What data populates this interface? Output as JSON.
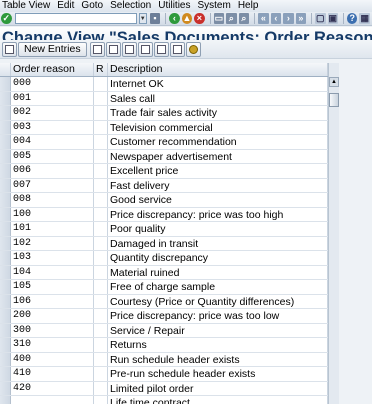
{
  "menu": [
    "Table View",
    "Edit",
    "Goto",
    "Selection",
    "Utilities",
    "System",
    "Help"
  ],
  "title": "Change View \"Sales Documents: Order Reasons\": O",
  "app_toolbar": {
    "new_entries_label": "New Entries"
  },
  "table": {
    "columns": [
      "Order reason",
      "R",
      "Description"
    ],
    "rows": [
      {
        "code": "000",
        "desc": "Internet OK"
      },
      {
        "code": "001",
        "desc": "Sales call"
      },
      {
        "code": "002",
        "desc": "Trade fair sales activity"
      },
      {
        "code": "003",
        "desc": "Television commercial"
      },
      {
        "code": "004",
        "desc": "Customer recommendation"
      },
      {
        "code": "005",
        "desc": "Newspaper advertisement"
      },
      {
        "code": "006",
        "desc": "Excellent price"
      },
      {
        "code": "007",
        "desc": "Fast delivery"
      },
      {
        "code": "008",
        "desc": "Good service"
      },
      {
        "code": "100",
        "desc": "Price discrepancy: price was too high"
      },
      {
        "code": "101",
        "desc": "Poor quality"
      },
      {
        "code": "102",
        "desc": "Damaged in transit"
      },
      {
        "code": "103",
        "desc": "Quantity discrepancy"
      },
      {
        "code": "104",
        "desc": "Material ruined"
      },
      {
        "code": "105",
        "desc": "Free of charge sample"
      },
      {
        "code": "106",
        "desc": "Courtesy (Price or Quantity differences)"
      },
      {
        "code": "200",
        "desc": "Price discrepancy: price was too low"
      },
      {
        "code": "300",
        "desc": "Service / Repair"
      },
      {
        "code": "310",
        "desc": "Returns"
      },
      {
        "code": "400",
        "desc": "Run schedule header exists"
      },
      {
        "code": "410",
        "desc": "Pre-run schedule header exists"
      },
      {
        "code": "420",
        "desc": "Limited pilot order"
      },
      {
        "code": "",
        "desc": "Life time contract"
      }
    ]
  },
  "colors": {
    "title": "#153a67",
    "bg": "#eef2f6"
  }
}
